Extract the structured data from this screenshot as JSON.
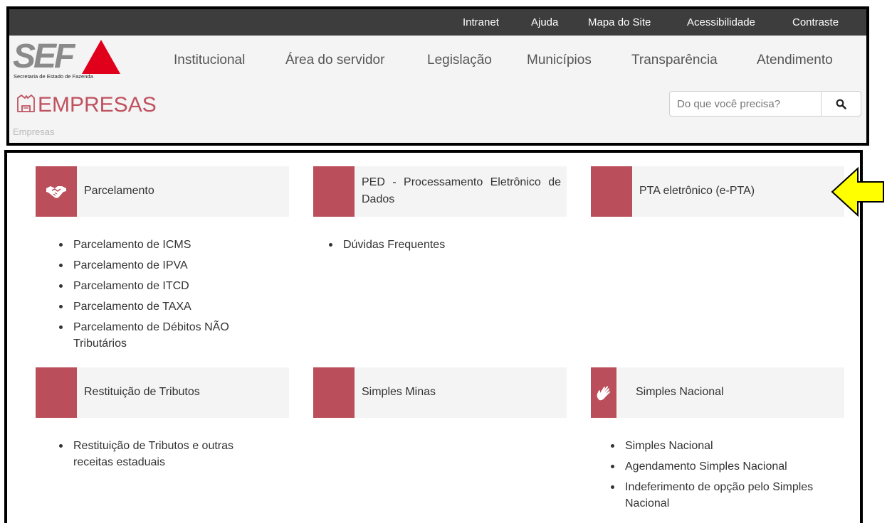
{
  "topbar": {
    "links": [
      "Intranet",
      "Ajuda",
      "Mapa do Site",
      "Acessibilidade",
      "Contraste"
    ]
  },
  "logo": {
    "text": "SEF",
    "subtitle": "Secretaria de Estado de Fazenda"
  },
  "nav": {
    "items": [
      "Institucional",
      "Área do servidor",
      "Legislação",
      "Municípios",
      "Transparência",
      "Atendimento"
    ]
  },
  "page": {
    "title": "EMPRESAS",
    "breadcrumb": "Empresas"
  },
  "search": {
    "placeholder": "Do que você precisa?",
    "icon": "search-icon"
  },
  "cards": [
    {
      "title": "Parcelamento",
      "icon": "handshake-icon",
      "links": [
        "Parcelamento de ICMS",
        "Parcelamento de IPVA",
        "Parcelamento de ITCD",
        "Parcelamento de TAXA",
        "Parcelamento de Débitos NÃO Tributários"
      ]
    },
    {
      "title": "PED - Processamento Eletrônico de Dados",
      "icon": "",
      "links": [
        "Dúvidas Frequentes"
      ]
    },
    {
      "title": "PTA eletrônico (e-PTA)",
      "icon": "",
      "links": []
    },
    {
      "title": "Restituição de Tributos",
      "icon": "",
      "links": [
        "Restituição de Tributos e outras receitas estaduais"
      ]
    },
    {
      "title": "Simples Minas",
      "icon": "",
      "links": []
    },
    {
      "title": "Simples Nacional",
      "icon": "hand-icon",
      "links": [
        "Simples Nacional",
        "Agendamento Simples Nacional",
        "Indeferimento de opção pelo Simples Nacional"
      ]
    }
  ],
  "colors": {
    "accent": "#bb4e5b",
    "title": "#c0515f",
    "topbar": "#3d3d3d",
    "logo_red": "#e0001b",
    "arrow": "#ffff00"
  }
}
